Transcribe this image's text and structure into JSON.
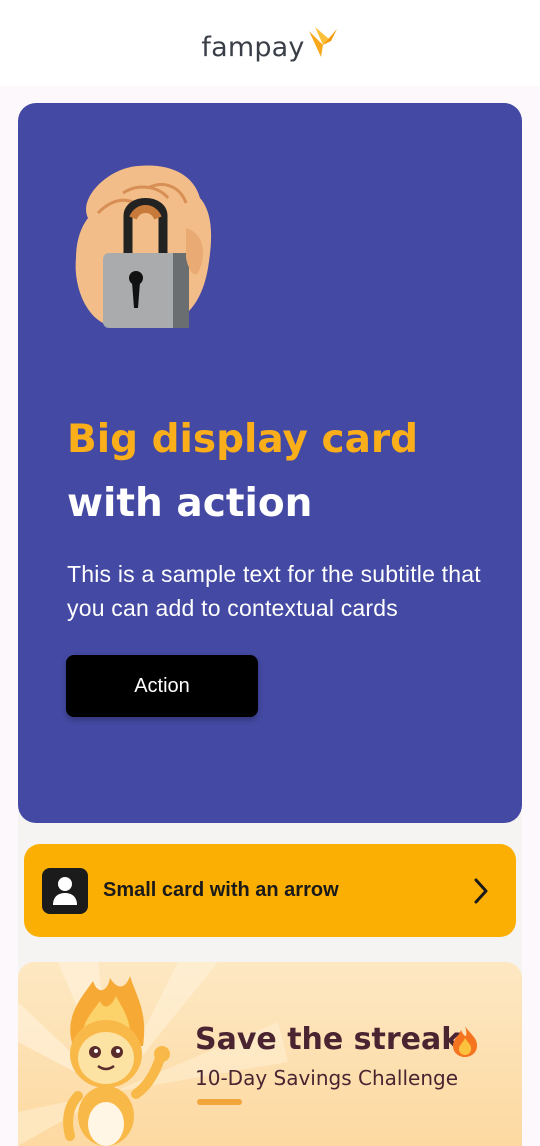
{
  "header": {
    "brand": "fampay",
    "logo_icon": "fampay-bird-icon"
  },
  "big_card": {
    "title_accent": "Big display card",
    "title_plain": "with action",
    "subtitle": "This is a sample text for the subtitle that you can add to contextual cards",
    "action_label": "Action",
    "illustration": "padlock-in-hand-icon",
    "colors": {
      "background": "#4449a3",
      "accent": "#f9ae1a",
      "button": "#000000"
    }
  },
  "small_card": {
    "label": "Small card with an arrow",
    "icon": "user-icon",
    "arrow_icon": "chevron-right-icon",
    "colors": {
      "background": "#fbaf03"
    }
  },
  "streak_card": {
    "title": "Save the streak",
    "subtitle": "10-Day Savings Challenge",
    "title_icon": "flame-icon",
    "mascot": "flame-mascot",
    "colors": {
      "text": "#4a2431",
      "accent": "#f2a53a"
    }
  }
}
